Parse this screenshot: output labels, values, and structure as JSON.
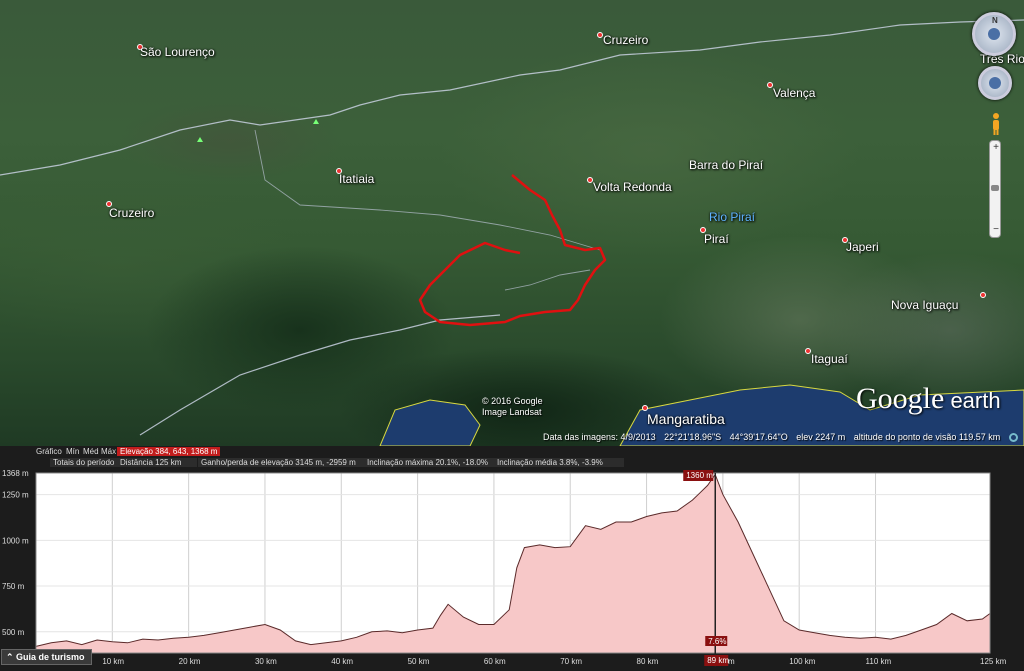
{
  "map": {
    "places": [
      {
        "id": "sao-lourenco",
        "label": "São Lourenço",
        "big": false
      },
      {
        "id": "cruzeiro-top",
        "label": "Cruzeiro",
        "big": false
      },
      {
        "id": "tres-rios",
        "label": "Três Rio",
        "big": false
      },
      {
        "id": "valenca",
        "label": "Valença",
        "big": false
      },
      {
        "id": "barra-do-pirai",
        "label": "Barra do Piraí",
        "big": false
      },
      {
        "id": "itatiaia",
        "label": "Itatiaia",
        "big": false
      },
      {
        "id": "volta-redonda",
        "label": "Volta Redonda",
        "big": false
      },
      {
        "id": "cruzeiro-left",
        "label": "Cruzeiro",
        "big": false
      },
      {
        "id": "rio-pirai",
        "label": "Rio Piraí",
        "big": false
      },
      {
        "id": "pirai",
        "label": "Piraí",
        "big": false
      },
      {
        "id": "japeri",
        "label": "Japeri",
        "big": false
      },
      {
        "id": "nova-iguacu",
        "label": "Nova Iguaçu",
        "big": false
      },
      {
        "id": "itaguai",
        "label": "Itaguaí",
        "big": false
      },
      {
        "id": "mangaratiba",
        "label": "Mangaratiba",
        "big": true
      }
    ],
    "copyright_line1": "© 2016 Google",
    "copyright_line2": "Image Landsat",
    "logo_main": "Google",
    "logo_suffix": " earth",
    "status": {
      "imagery_date": "Data das imagens: 4/9/2013",
      "lat": "22°21'18.96\"S",
      "lon": "44°39'17.64\"O",
      "elev": "elev  2247 m",
      "eye_alt": "altitude do ponto de visão 119.57 km"
    },
    "nav_north": "N",
    "zoom_plus": "+",
    "zoom_minus": "−"
  },
  "elevation_panel": {
    "row1": {
      "grafico": "Gráfico",
      "min": "Mín",
      "med": "Méd",
      "max": "Máx",
      "elevacao": "Elevação  384, 643, 1368 m"
    },
    "row2": {
      "totais": "Totais do período",
      "distancia": "Distância  125 km",
      "ganho": "Ganho/perda de elevação  3145 m, -2959 m",
      "incl_max": "Inclinação máxima  20.1%, -18.0%",
      "incl_media": "Inclinação média  3.8%, -3.9%"
    },
    "tour_button": "Guia de turismo",
    "cursor_elev_label": "1360 m",
    "cursor_slope_label": "7.6%",
    "cursor_dist_label": "89 km"
  },
  "chart_data": {
    "type": "area",
    "xlabel": "",
    "ylabel": "",
    "x_tick_labels": [
      "10 km",
      "20 km",
      "30 km",
      "40 km",
      "50 km",
      "60 km",
      "70 km",
      "80 km",
      "90 km",
      "100 km",
      "110 km",
      "125 km"
    ],
    "x_tick_values": [
      10,
      20,
      30,
      40,
      50,
      60,
      70,
      80,
      90,
      100,
      110,
      125
    ],
    "y_tick_labels": [
      "1368 m",
      "1250 m",
      "1000 m",
      "750 m",
      "500 m",
      "384 m"
    ],
    "y_tick_values": [
      1368,
      1250,
      1000,
      750,
      500,
      384
    ],
    "xlim": [
      0,
      125
    ],
    "ylim": [
      384,
      1368
    ],
    "grid": true,
    "cursor_x": 89,
    "series": [
      {
        "x": [
          0,
          2,
          4,
          6,
          8,
          10,
          12,
          14,
          16,
          18,
          20,
          22,
          24,
          26,
          28,
          30,
          32,
          34,
          36,
          38,
          40,
          42,
          44,
          46,
          48,
          50,
          52,
          53,
          54,
          56,
          58,
          60,
          62,
          63,
          64,
          66,
          68,
          70,
          72,
          74,
          76,
          78,
          80,
          82,
          84,
          86,
          87,
          88,
          89,
          90,
          92,
          94,
          96,
          98,
          100,
          102,
          104,
          106,
          108,
          110,
          112,
          114,
          116,
          118,
          120,
          122,
          124,
          125
        ],
        "y": [
          420,
          440,
          450,
          430,
          455,
          445,
          440,
          460,
          455,
          465,
          470,
          480,
          495,
          510,
          525,
          540,
          510,
          450,
          430,
          440,
          450,
          470,
          500,
          505,
          495,
          510,
          520,
          590,
          650,
          580,
          540,
          540,
          620,
          850,
          960,
          975,
          960,
          965,
          1080,
          1060,
          1100,
          1100,
          1130,
          1150,
          1160,
          1220,
          1260,
          1300,
          1360,
          1250,
          1100,
          920,
          740,
          560,
          510,
          495,
          480,
          470,
          465,
          470,
          460,
          480,
          510,
          540,
          600,
          560,
          570,
          600
        ]
      }
    ]
  }
}
